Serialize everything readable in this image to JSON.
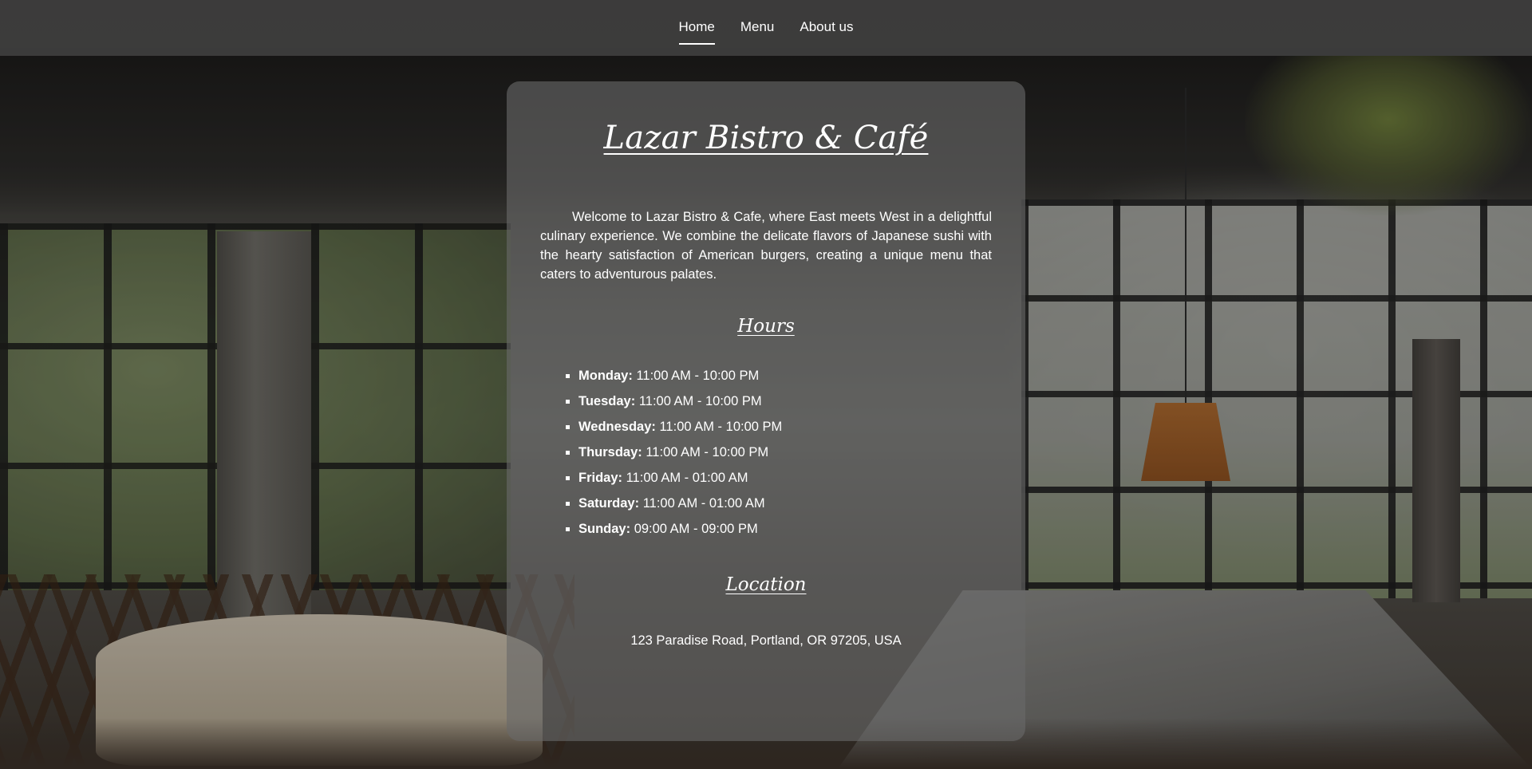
{
  "nav": {
    "items": [
      {
        "label": "Home",
        "active": true
      },
      {
        "label": "Menu",
        "active": false
      },
      {
        "label": "About us",
        "active": false
      }
    ]
  },
  "main": {
    "title": "Lazar Bistro & Café",
    "intro": "Welcome to Lazar Bistro & Cafe, where East meets West in a delightful culinary experience. We combine the delicate flavors of Japanese sushi with the hearty satisfaction of American burgers, creating a unique menu that caters to adventurous palates.",
    "hours_heading": "Hours",
    "hours": [
      {
        "day": "Monday:",
        "time": "11:00 AM - 10:00 PM"
      },
      {
        "day": "Tuesday:",
        "time": "11:00 AM - 10:00 PM"
      },
      {
        "day": "Wednesday:",
        "time": "11:00 AM - 10:00 PM"
      },
      {
        "day": "Thursday:",
        "time": "11:00 AM - 10:00 PM"
      },
      {
        "day": "Friday:",
        "time": "11:00 AM - 01:00 AM"
      },
      {
        "day": "Saturday:",
        "time": "11:00 AM - 01:00 AM"
      },
      {
        "day": "Sunday:",
        "time": "09:00 AM - 09:00 PM"
      }
    ],
    "location_heading": "Location",
    "address": "123 Paradise Road, Portland, OR 97205, USA"
  },
  "colors": {
    "nav_background": "#3e3e3e",
    "card_background": "#696969",
    "text": "#ffffff"
  }
}
